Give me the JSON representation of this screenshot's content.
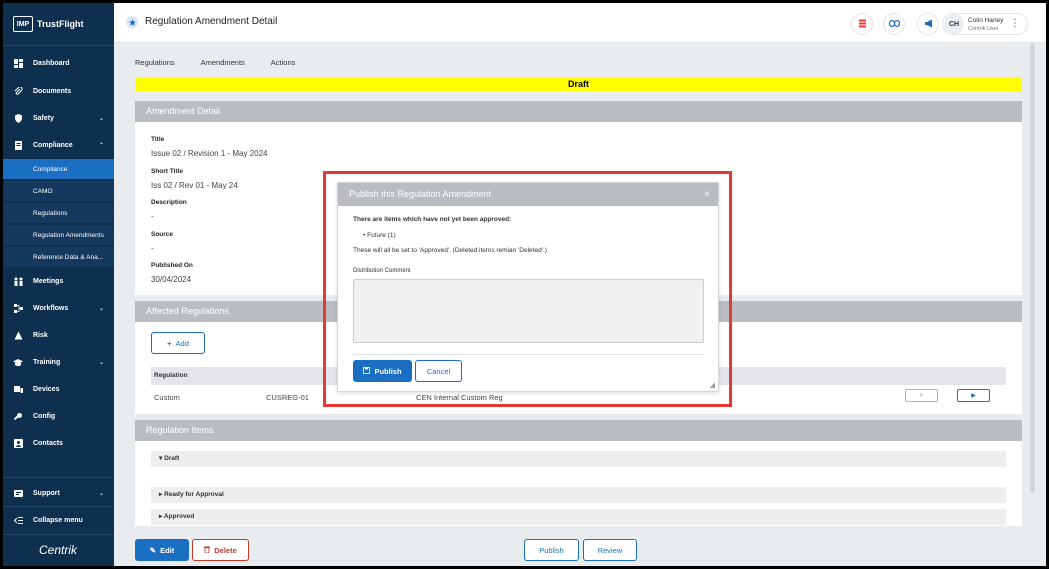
{
  "brand": {
    "logo": "IMP",
    "name": "TrustFlight"
  },
  "sidebar": {
    "items": [
      {
        "label": "Dashboard",
        "icon": "dashboard-icon"
      },
      {
        "label": "Documents",
        "icon": "paperclip-icon"
      },
      {
        "label": "Safety",
        "icon": "shield-icon",
        "expandable": true
      },
      {
        "label": "Compliance",
        "icon": "compliance-icon",
        "expandable": true,
        "expanded": true
      },
      {
        "label": "Meetings",
        "icon": "meetings-icon"
      },
      {
        "label": "Workflows",
        "icon": "workflows-icon",
        "expandable": true
      },
      {
        "label": "Risk",
        "icon": "risk-icon"
      },
      {
        "label": "Training",
        "icon": "graduation-cap-icon",
        "expandable": true
      },
      {
        "label": "Devices",
        "icon": "devices-icon"
      },
      {
        "label": "Config",
        "icon": "config-icon"
      },
      {
        "label": "Contacts",
        "icon": "contacts-icon"
      }
    ],
    "compliance_sub": [
      "Compliance",
      "CAMO",
      "Regulations",
      "Regulation Amendments",
      "Reference Data & Ana..."
    ],
    "support": "Support",
    "collapse": "Collapse menu",
    "footer_logo": "Centrik"
  },
  "header": {
    "title": "Regulation Amendment Detail",
    "user": {
      "initials": "CH",
      "name": "Colin Harley",
      "role": "Centrik User"
    }
  },
  "tabs": [
    "Regulations",
    "Amendments",
    "Actions"
  ],
  "status_banner": "Draft",
  "amendment_detail": {
    "heading": "Amendment Detail",
    "fields": [
      {
        "label": "Title",
        "value": "Issue 02 / Revision 1 - May 2024"
      },
      {
        "label": "Short Title",
        "value": "Iss 02 / Rev 01 - May 24"
      },
      {
        "label": "Description",
        "value": "-"
      },
      {
        "label": "Source",
        "value": "-"
      },
      {
        "label": "Published On",
        "value": "30/04/2024"
      }
    ]
  },
  "affected_regulations": {
    "heading": "Affected Regulations",
    "add_label": "Add",
    "column_header": "Regulation",
    "row": {
      "type": "Custom",
      "code": "CUSREG-01",
      "name": "CEN Internal Custom Reg"
    }
  },
  "regulation_items": {
    "heading": "Regulation Items",
    "groups": [
      "Draft",
      "Ready for Approval",
      "Approved"
    ]
  },
  "footer": {
    "edit": "Edit",
    "delete": "Delete",
    "publish": "Publish",
    "review": "Review"
  },
  "modal": {
    "title": "Publish this Regulation Amendment",
    "warning": "There are items which have not yet been approved:",
    "list_item": "Future (1)",
    "note": "These will all be set to 'Approved'. (Deleted items remian 'Deleted'.)",
    "comment_label": "Distribution Comment",
    "comment_value": "",
    "publish": "Publish",
    "cancel": "Cancel"
  },
  "colors": {
    "sidebar_bg": "#0f2f4f",
    "accent": "#1b6fc2",
    "draft_banner": "#ffff00",
    "highlight_border": "#e53935",
    "danger": "#c0392b"
  }
}
